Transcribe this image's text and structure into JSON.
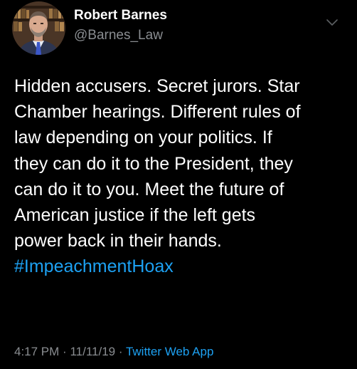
{
  "colors": {
    "background": "#000000",
    "text": "#ffffff",
    "secondary": "#8a8d91",
    "accent": "#1da1f2"
  },
  "author": {
    "name": "Robert Barnes",
    "handle": "@Barnes_Law",
    "avatar": "profile-photo",
    "menu_icon": "chevron-down-icon"
  },
  "tweet": {
    "lines": [
      "Hidden accusers. Secret jurors. Star",
      "Chamber hearings. Different rules of",
      "law depending on your politics. If",
      "they can do it to the President, they",
      "can do it to you. Meet the future of",
      "American justice if the left gets",
      "power back in their hands."
    ],
    "hashtag": "#ImpeachmentHoax"
  },
  "meta": {
    "time": "4:17 PM",
    "separator": "·",
    "date": "11/11/19",
    "source": "Twitter Web App"
  }
}
